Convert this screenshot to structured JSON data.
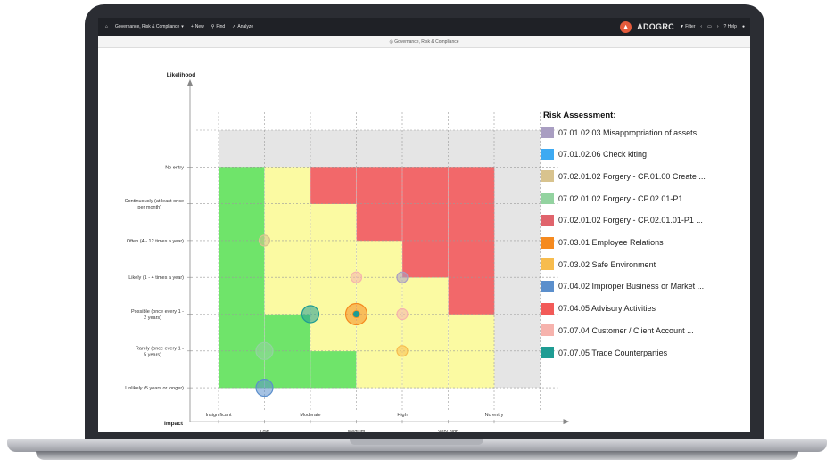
{
  "app": {
    "title": "Governance, Risk & Compliance",
    "menu": [
      "New",
      "Find",
      "Analyze"
    ],
    "brand": "ADOGRC",
    "right_menu": [
      "Filter",
      "Help"
    ]
  },
  "chart_data": {
    "type": "heatmap",
    "ylabel": "Likelihood",
    "xlabel": "Impact",
    "y_categories": [
      "Unlikely (5 years or longer)",
      "Rarely (once every 1 - 5 years)",
      "Possible (once every 1 - 2 years)",
      "Likely (1 - 4 times a year)",
      "Often (4 - 12 times a year)",
      "Continuously (at least once per month)",
      "No entry"
    ],
    "x_categories": [
      "Insignificant",
      "Low",
      "Moderate",
      "Medium",
      "High",
      "Very high",
      "No entry"
    ],
    "grid": true,
    "zone_colors": {
      "green": "#6fe46a",
      "yellow": "#fbfaa2",
      "red": "#f2686a",
      "noentry": "#e5e5e5"
    },
    "zones": [
      [
        "green",
        "green",
        "green",
        "yellow",
        "yellow",
        "yellow"
      ],
      [
        "green",
        "green",
        "yellow",
        "yellow",
        "yellow",
        "yellow"
      ],
      [
        "green",
        "yellow",
        "yellow",
        "yellow",
        "yellow",
        "red"
      ],
      [
        "green",
        "yellow",
        "yellow",
        "yellow",
        "red",
        "red"
      ],
      [
        "green",
        "yellow",
        "yellow",
        "red",
        "red",
        "red"
      ],
      [
        "green",
        "yellow",
        "red",
        "red",
        "red",
        "red"
      ]
    ],
    "points": [
      {
        "series": "07.02.01.02 Forgery - CP.01.00 Create ...",
        "x": "Low",
        "y": "Often (4 - 12 times a year)",
        "size": 1
      },
      {
        "series": "07.02.01.02 Forgery - CP.02.01-P1 ...",
        "x": "Low",
        "y": "Rarely (once every 1 - 5 years)",
        "size": 2
      },
      {
        "series": "07.04.02 Improper Business or Market ...",
        "x": "Low",
        "y": "Unlikely (5 years or longer)",
        "size": 2
      },
      {
        "series": "07.07.05 Trade Counterparties",
        "x": "Moderate",
        "y": "Possible (once every 1 - 2 years)",
        "size": 2
      },
      {
        "series": "07.03.01 Employee Relations",
        "x": "Medium",
        "y": "Possible (once every 1 - 2 years)",
        "size": 3
      },
      {
        "series": "07.07.04 Customer / Client Account ...",
        "x": "Medium",
        "y": "Likely (1 - 4 times a year)",
        "size": 1
      },
      {
        "series": "07.01.02.03 Misappropriation of assets",
        "x": "High",
        "y": "Likely (1 - 4 times a year)",
        "size": 1
      },
      {
        "series": "07.07.04 Customer / Client Account ...",
        "x": "High",
        "y": "Possible (once every 1 - 2 years)",
        "size": 1
      },
      {
        "series": "07.03.02 Safe Environment",
        "x": "High",
        "y": "Rarely (once every 1 - 5 years)",
        "size": 1
      }
    ],
    "legend": {
      "title": "Risk Assessment:",
      "position": "right",
      "items": [
        {
          "label": "07.01.02.03 Misappropriation of assets",
          "color": "#a99ec2"
        },
        {
          "label": "07.01.02.06 Check kiting",
          "color": "#3daaf2"
        },
        {
          "label": "07.02.01.02 Forgery - CP.01.00 Create ...",
          "color": "#d8c38e"
        },
        {
          "label": "07.02.01.02 Forgery - CP.02.01-P1 ...",
          "color": "#93d3a0"
        },
        {
          "label": "07.02.01.02 Forgery - CP.02.01.01-P1 ...",
          "color": "#e0646c"
        },
        {
          "label": "07.03.01 Employee Relations",
          "color": "#f58a1f"
        },
        {
          "label": "07.03.02 Safe Environment",
          "color": "#f7bc4e"
        },
        {
          "label": "07.04.02 Improper Business or Market ...",
          "color": "#5b8fcc"
        },
        {
          "label": "07.04.05 Advisory Activities",
          "color": "#f25a58"
        },
        {
          "label": "07.07.04 Customer / Client Account ...",
          "color": "#f6b3ad"
        },
        {
          "label": "07.07.05 Trade Counterparties",
          "color": "#1f9c93"
        }
      ]
    }
  }
}
